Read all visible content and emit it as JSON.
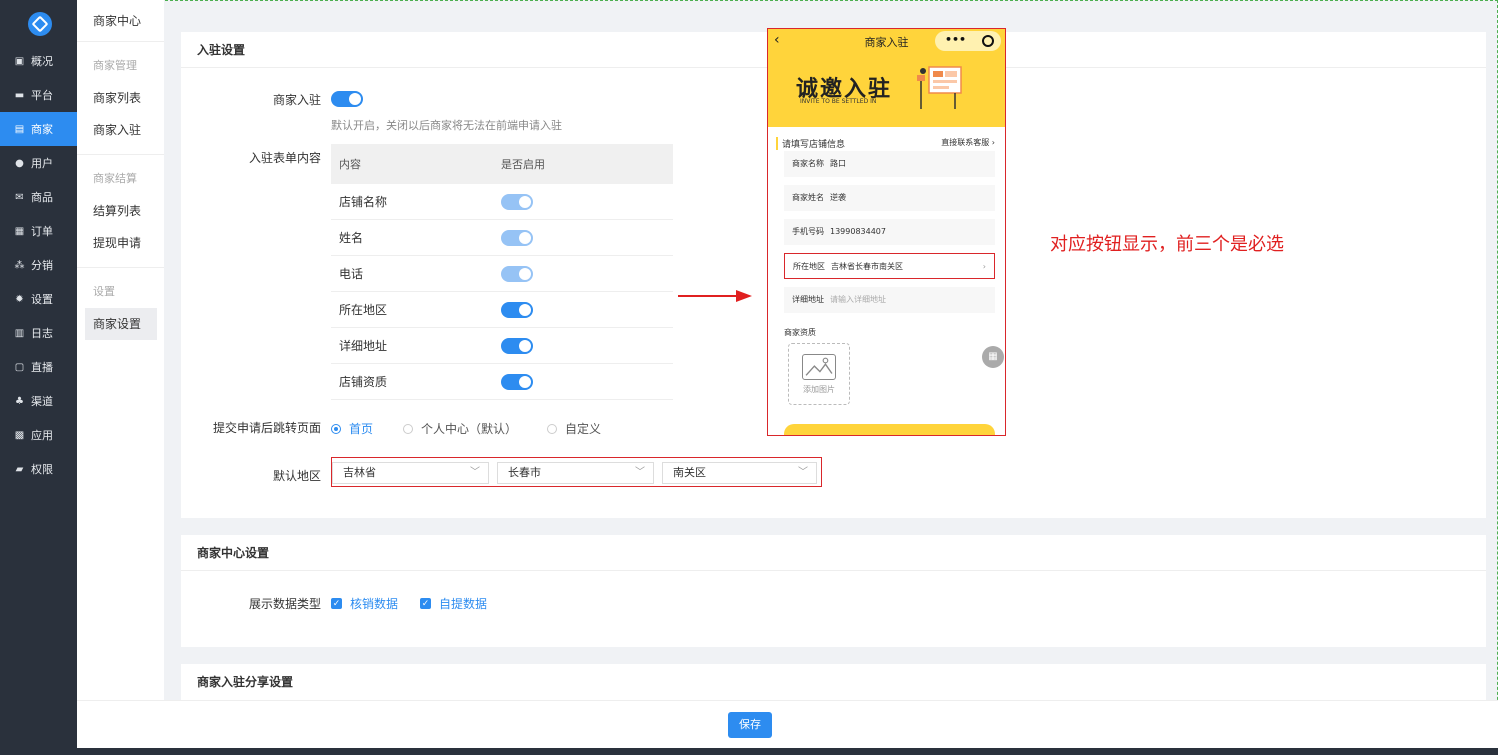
{
  "nav_primary": [
    {
      "label": "概况",
      "icon": "chat-icon",
      "glyph": "▣"
    },
    {
      "label": "平台",
      "icon": "monitor-icon",
      "glyph": "▬"
    },
    {
      "label": "商家",
      "icon": "store-icon",
      "glyph": "▤"
    },
    {
      "label": "用户",
      "icon": "user-icon",
      "glyph": "●"
    },
    {
      "label": "商品",
      "icon": "goods-icon",
      "glyph": "✉"
    },
    {
      "label": "订单",
      "icon": "order-icon",
      "glyph": "▦"
    },
    {
      "label": "分销",
      "icon": "share-icon",
      "glyph": "⁂"
    },
    {
      "label": "设置",
      "icon": "gear-icon",
      "glyph": "✹"
    },
    {
      "label": "日志",
      "icon": "log-icon",
      "glyph": "▥"
    },
    {
      "label": "直播",
      "icon": "live-icon",
      "glyph": "▢"
    },
    {
      "label": "渠道",
      "icon": "channel-icon",
      "glyph": "♣"
    },
    {
      "label": "应用",
      "icon": "apps-icon",
      "glyph": "▩"
    },
    {
      "label": "权限",
      "icon": "lock-icon",
      "glyph": "▰"
    }
  ],
  "nav_primary_active": 2,
  "nav_secondary": {
    "header": "商家中心",
    "groups": [
      {
        "title": "商家管理",
        "items": [
          "商家列表",
          "商家入驻"
        ]
      },
      {
        "title": "商家结算",
        "items": [
          "结算列表",
          "提现申请"
        ]
      },
      {
        "title": "设置",
        "items": [
          "商家设置"
        ]
      }
    ]
  },
  "entry_settings": {
    "title": "入驻设置",
    "merchant_entry_label": "商家入驻",
    "merchant_entry_enabled": true,
    "merchant_entry_hint": "默认开启，关闭以后商家将无法在前端申请入驻",
    "form_content_label": "入驻表单内容",
    "table_headers": [
      "内容",
      "是否启用"
    ],
    "rows": [
      {
        "name": "店铺名称",
        "enabled": true,
        "required": true
      },
      {
        "name": "姓名",
        "enabled": true,
        "required": true
      },
      {
        "name": "电话",
        "enabled": true,
        "required": true
      },
      {
        "name": "所在地区",
        "enabled": true,
        "required": false
      },
      {
        "name": "详细地址",
        "enabled": true,
        "required": false
      },
      {
        "name": "店铺资质",
        "enabled": true,
        "required": false
      }
    ],
    "redirect_label": "提交申请后跳转页面",
    "redirect_options": [
      "首页",
      "个人中心（默认）",
      "自定义"
    ],
    "redirect_selected": 0,
    "region_label": "默认地区",
    "region": {
      "province": "吉林省",
      "city": "长春市",
      "district": "南关区"
    }
  },
  "center_settings": {
    "title": "商家中心设置",
    "display_label": "展示数据类型",
    "options": [
      "核销数据",
      "自提数据"
    ]
  },
  "share_settings": {
    "title": "商家入驻分享设置"
  },
  "footer": {
    "save_label": "保存"
  },
  "annotation": "对应按钮显示，前三个是必选",
  "phone": {
    "title": "商家入驻",
    "dots": "•••",
    "banner_title": "诚邀入驻",
    "banner_sub": "INVITE TO BE SETTLED IN",
    "section_title": "请填写店铺信息",
    "contact": "直接联系客服",
    "fields": [
      {
        "key": "商家名称",
        "value": "路口"
      },
      {
        "key": "商家姓名",
        "value": "逆袭"
      },
      {
        "key": "手机号码",
        "value": "13990834407"
      },
      {
        "key": "所在地区",
        "value": "吉林省长春市南关区"
      },
      {
        "key": "详细地址",
        "value": "",
        "placeholder": "请输入详细地址"
      }
    ],
    "upload_label": "商家资质",
    "upload_button": "添加图片"
  },
  "colors": {
    "primary": "#2d8cf0",
    "sidebar": "#2a313c",
    "highlight": "#d9272b",
    "banner": "#ffd43b"
  }
}
